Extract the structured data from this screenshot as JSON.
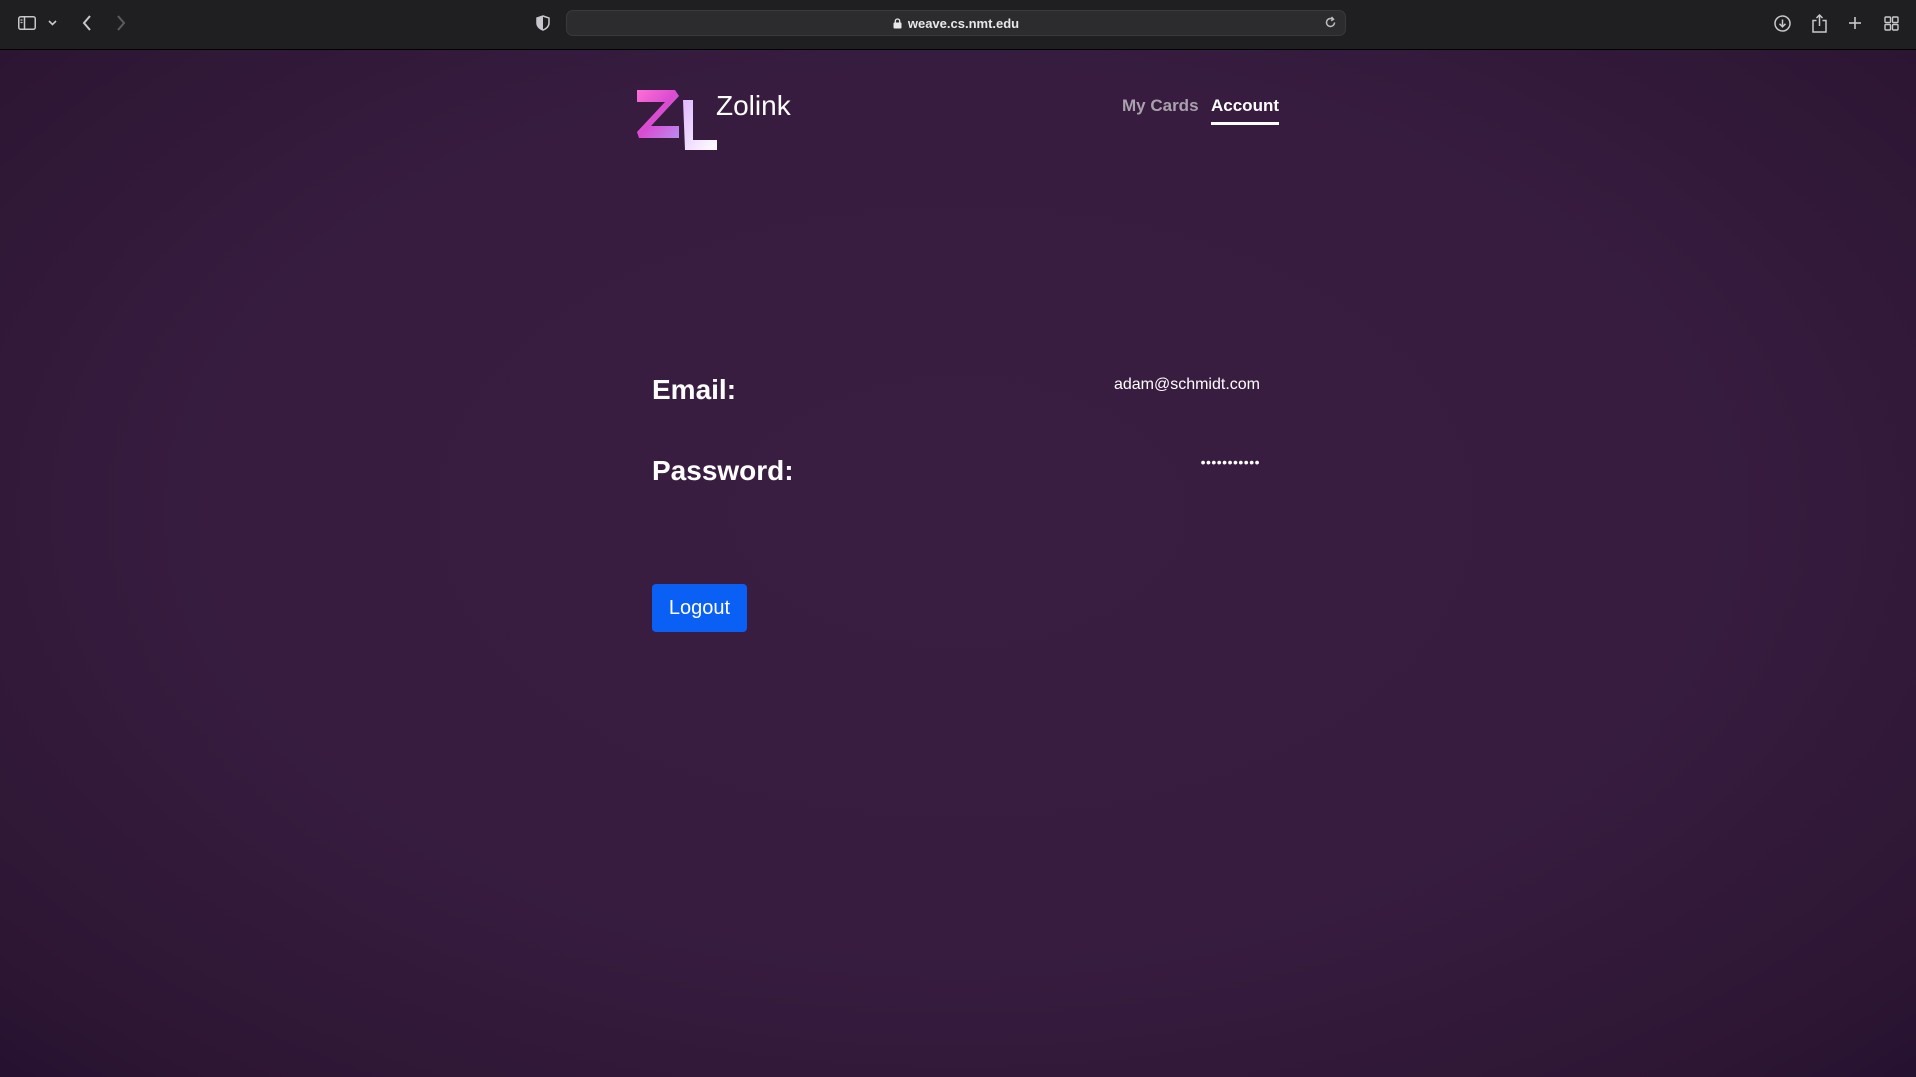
{
  "browser": {
    "url": "weave.cs.nmt.edu",
    "icons": [
      "sidebar-icon",
      "chevron-down-icon",
      "back-icon",
      "forward-icon",
      "shield-icon",
      "lock-icon",
      "reload-icon",
      "download-icon",
      "share-icon",
      "plus-icon",
      "tabs-grid-icon"
    ]
  },
  "brand": {
    "name": "Zolink",
    "logo_colors": [
      "#e040c8",
      "#c58cf0",
      "#ffffff"
    ]
  },
  "nav": {
    "my_cards": "My Cards",
    "account": "Account",
    "active": "account"
  },
  "account": {
    "email_label": "Email:",
    "email_value": "adam@schmidt.com",
    "password_label": "Password:",
    "password_value": "•••••••••••"
  },
  "actions": {
    "logout_label": "Logout",
    "logout_color": "#0a5ff5"
  }
}
